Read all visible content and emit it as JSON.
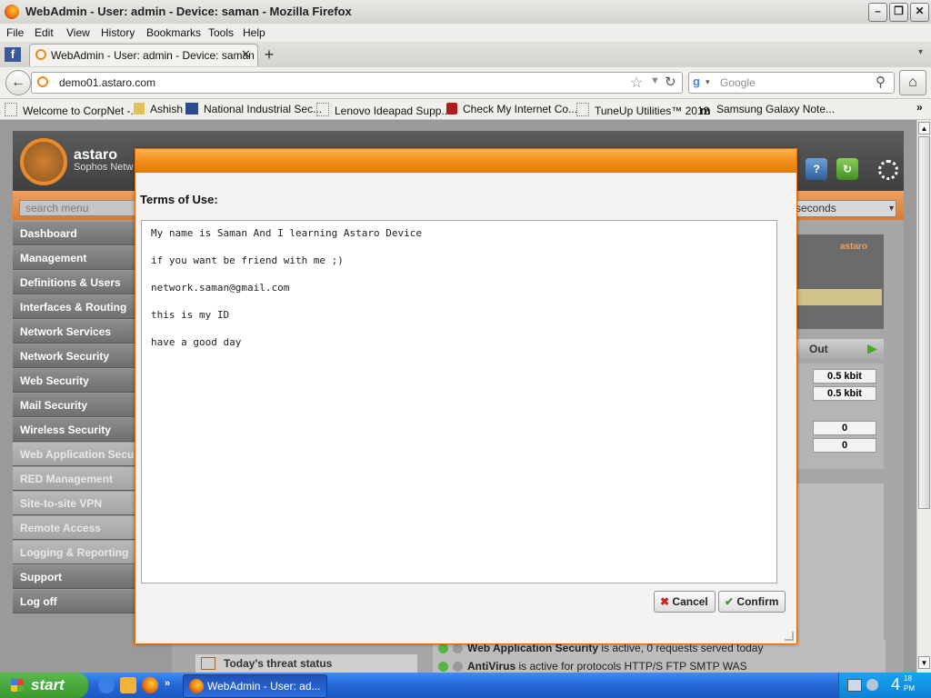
{
  "window": {
    "title": "WebAdmin - User: admin - Device: saman - Mozilla Firefox"
  },
  "menubar": {
    "items": [
      "File",
      "Edit",
      "View",
      "History",
      "Bookmarks",
      "Tools",
      "Help"
    ]
  },
  "tabs": [
    {
      "label": "WebAdmin - User: admin - Device: saman"
    }
  ],
  "nav": {
    "url": "demo01.astaro.com",
    "search_placeholder": "Google"
  },
  "bookmarks": [
    {
      "label": "Welcome to CorpNet -..."
    },
    {
      "label": "Ashish"
    },
    {
      "label": "National Industrial Sec..."
    },
    {
      "label": "Lenovo Ideapad Supp..."
    },
    {
      "label": "Check My Internet Co..."
    },
    {
      "label": "TuneUp Utilities™ 2012"
    },
    {
      "label": "Samsung Galaxy Note..."
    }
  ],
  "app": {
    "logo_text": "astaro",
    "logo_sub": "Sophos Netw",
    "search_placeholder": "search menu",
    "refresh_select": "seconds",
    "sidebar": [
      {
        "label": "Dashboard"
      },
      {
        "label": "Management"
      },
      {
        "label": "Definitions & Users"
      },
      {
        "label": "Interfaces & Routing"
      },
      {
        "label": "Network Services"
      },
      {
        "label": "Network Security"
      },
      {
        "label": "Web Security"
      },
      {
        "label": "Mail Security"
      },
      {
        "label": "Wireless Security"
      },
      {
        "label": "Web Application Secu"
      },
      {
        "label": "RED Management"
      },
      {
        "label": "Site-to-site VPN"
      },
      {
        "label": "Remote Access"
      },
      {
        "label": "Logging & Reporting"
      },
      {
        "label": "Support"
      },
      {
        "label": "Log off"
      }
    ],
    "out_header": "Out",
    "out_values": [
      "0.5 kbit",
      "0.5 kbit",
      "0",
      "0"
    ],
    "threat_status": "Today's threat status",
    "status_lines": [
      {
        "name": "Web Application Security",
        "text": "is active, 0 requests served today"
      },
      {
        "name": "AntiVirus",
        "text": "is active for protocols HTTP/S FTP SMTP WAS"
      }
    ]
  },
  "dialog": {
    "title": "Terms of Use:",
    "lines": [
      "My name is Saman And I learning Astaro Device",
      "if you want be friend with me ;)",
      "network.saman@gmail.com",
      "this is my ID",
      "have a good day"
    ],
    "cancel_label": "Cancel",
    "confirm_label": "Confirm"
  },
  "taskbar": {
    "start_label": "start",
    "task_label": "WebAdmin - User: ad...",
    "clock": "4",
    "clock_small": "18",
    "clock_ampm": "PM"
  },
  "colors": {
    "accent": "#f08a16",
    "sidebar": "#7f7f7f",
    "taskbar": "#2466d4"
  }
}
